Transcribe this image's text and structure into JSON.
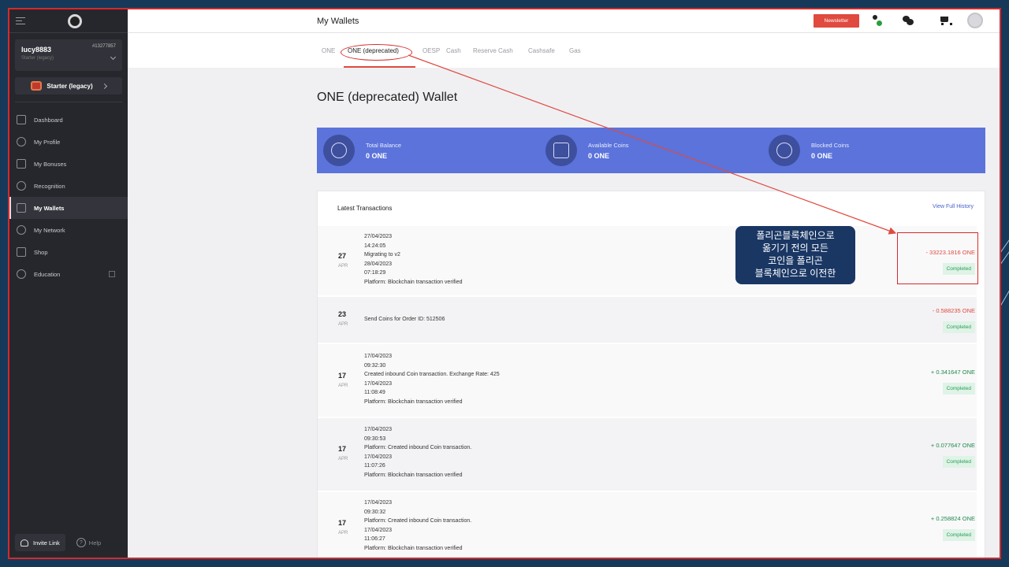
{
  "sidebar": {
    "user": {
      "name": "lucy8883",
      "id": "#13277857",
      "level": "Starter (legacy)"
    },
    "plan_button": "Starter (legacy)",
    "nav": [
      {
        "label": "Dashboard",
        "icon": "home-icon"
      },
      {
        "label": "My Profile",
        "icon": "user-icon"
      },
      {
        "label": "My Bonuses",
        "icon": "gift-icon"
      },
      {
        "label": "Recognition",
        "icon": "star-icon"
      },
      {
        "label": "My Wallets",
        "icon": "wallet-icon",
        "active": true
      },
      {
        "label": "My Network",
        "icon": "network-icon"
      },
      {
        "label": "Shop",
        "icon": "cart-icon"
      },
      {
        "label": "Education",
        "icon": "education-icon"
      }
    ],
    "invite_label": "Invite Link",
    "help_label": "Help"
  },
  "header": {
    "title": "My Wallets",
    "newsletter_label": "Newsletter"
  },
  "tabs": [
    "ONE",
    "ONE (deprecated)",
    "OESP",
    "Cash",
    "Reserve Cash",
    "Cashsafe",
    "Gas"
  ],
  "active_tab": "ONE (deprecated)",
  "page_title": "ONE (deprecated) Wallet",
  "balances": [
    {
      "label": "Total Balance",
      "value": "0 ONE",
      "icon": "coins-icon"
    },
    {
      "label": "Available Coins",
      "value": "0 ONE",
      "icon": "safe-icon"
    },
    {
      "label": "Blocked Coins",
      "value": "0 ONE",
      "icon": "shield-icon"
    }
  ],
  "transactions_title": "Latest Transactions",
  "view_history_label": "View Full History",
  "transactions": [
    {
      "day": "27",
      "month": "APR",
      "lines": [
        "27/04/2023",
        "14:24:05",
        "Migrating to v2",
        "28/04/2023",
        "07:18:29",
        "Platform: Blockchain transaction verified"
      ],
      "amount": "- 33223.1816 ONE",
      "status": "Completed"
    },
    {
      "day": "23",
      "month": "APR",
      "lines": [
        "Send Coins for Order ID: 512506"
      ],
      "amount": "- 0.588235 ONE",
      "status": "Completed"
    },
    {
      "day": "17",
      "month": "APR",
      "lines": [
        "17/04/2023",
        "09:32:30",
        "Created inbound Coin transaction. Exchange Rate: 425",
        "17/04/2023",
        "11:08:49",
        "Platform: Blockchain transaction verified"
      ],
      "amount": "+ 0.341647 ONE",
      "status": "Completed"
    },
    {
      "day": "17",
      "month": "APR",
      "lines": [
        "17/04/2023",
        "09:30:53",
        "Platform: Created inbound Coin transaction.",
        "17/04/2023",
        "11:07:26",
        "Platform: Blockchain transaction verified"
      ],
      "amount": "+ 0.077647 ONE",
      "status": "Completed"
    },
    {
      "day": "17",
      "month": "APR",
      "lines": [
        "17/04/2023",
        "09:30:32",
        "Platform: Created inbound Coin transaction.",
        "17/04/2023",
        "11:06:27",
        "Platform: Blockchain transaction verified"
      ],
      "amount": "+ 0.258824 ONE",
      "status": "Completed"
    }
  ],
  "annotation": {
    "lines": [
      "폴리곤블록체인으로",
      "옮기기 전의 모든",
      "코인을 폴리곤",
      "블록체인으로 이전한"
    ]
  },
  "colors": {
    "accent": "#5b73db",
    "annotation_red": "#d42a2a",
    "negative": "#e04a3f",
    "positive": "#1f8a4a",
    "sidebar": "#26272d"
  }
}
